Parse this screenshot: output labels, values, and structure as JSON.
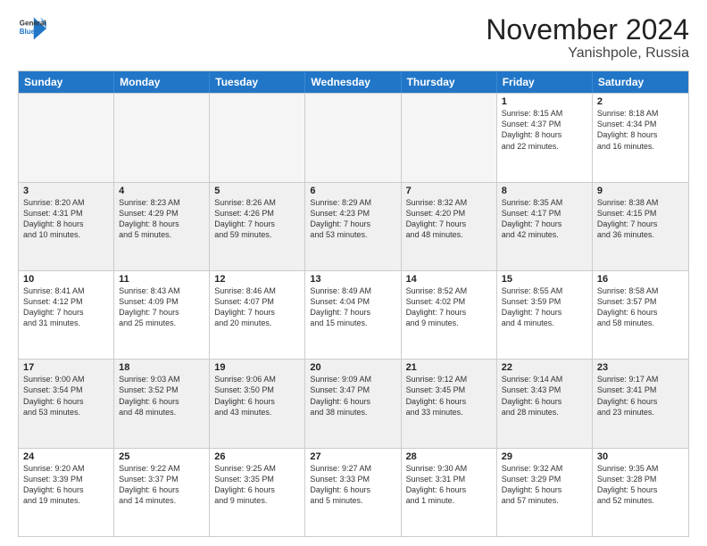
{
  "logo": {
    "general": "General",
    "blue": "Blue"
  },
  "title": "November 2024",
  "location": "Yanishpole, Russia",
  "days": [
    "Sunday",
    "Monday",
    "Tuesday",
    "Wednesday",
    "Thursday",
    "Friday",
    "Saturday"
  ],
  "weeks": [
    [
      {
        "day": "",
        "info": ""
      },
      {
        "day": "",
        "info": ""
      },
      {
        "day": "",
        "info": ""
      },
      {
        "day": "",
        "info": ""
      },
      {
        "day": "",
        "info": ""
      },
      {
        "day": "1",
        "info": "Sunrise: 8:15 AM\nSunset: 4:37 PM\nDaylight: 8 hours\nand 22 minutes."
      },
      {
        "day": "2",
        "info": "Sunrise: 8:18 AM\nSunset: 4:34 PM\nDaylight: 8 hours\nand 16 minutes."
      }
    ],
    [
      {
        "day": "3",
        "info": "Sunrise: 8:20 AM\nSunset: 4:31 PM\nDaylight: 8 hours\nand 10 minutes."
      },
      {
        "day": "4",
        "info": "Sunrise: 8:23 AM\nSunset: 4:29 PM\nDaylight: 8 hours\nand 5 minutes."
      },
      {
        "day": "5",
        "info": "Sunrise: 8:26 AM\nSunset: 4:26 PM\nDaylight: 7 hours\nand 59 minutes."
      },
      {
        "day": "6",
        "info": "Sunrise: 8:29 AM\nSunset: 4:23 PM\nDaylight: 7 hours\nand 53 minutes."
      },
      {
        "day": "7",
        "info": "Sunrise: 8:32 AM\nSunset: 4:20 PM\nDaylight: 7 hours\nand 48 minutes."
      },
      {
        "day": "8",
        "info": "Sunrise: 8:35 AM\nSunset: 4:17 PM\nDaylight: 7 hours\nand 42 minutes."
      },
      {
        "day": "9",
        "info": "Sunrise: 8:38 AM\nSunset: 4:15 PM\nDaylight: 7 hours\nand 36 minutes."
      }
    ],
    [
      {
        "day": "10",
        "info": "Sunrise: 8:41 AM\nSunset: 4:12 PM\nDaylight: 7 hours\nand 31 minutes."
      },
      {
        "day": "11",
        "info": "Sunrise: 8:43 AM\nSunset: 4:09 PM\nDaylight: 7 hours\nand 25 minutes."
      },
      {
        "day": "12",
        "info": "Sunrise: 8:46 AM\nSunset: 4:07 PM\nDaylight: 7 hours\nand 20 minutes."
      },
      {
        "day": "13",
        "info": "Sunrise: 8:49 AM\nSunset: 4:04 PM\nDaylight: 7 hours\nand 15 minutes."
      },
      {
        "day": "14",
        "info": "Sunrise: 8:52 AM\nSunset: 4:02 PM\nDaylight: 7 hours\nand 9 minutes."
      },
      {
        "day": "15",
        "info": "Sunrise: 8:55 AM\nSunset: 3:59 PM\nDaylight: 7 hours\nand 4 minutes."
      },
      {
        "day": "16",
        "info": "Sunrise: 8:58 AM\nSunset: 3:57 PM\nDaylight: 6 hours\nand 58 minutes."
      }
    ],
    [
      {
        "day": "17",
        "info": "Sunrise: 9:00 AM\nSunset: 3:54 PM\nDaylight: 6 hours\nand 53 minutes."
      },
      {
        "day": "18",
        "info": "Sunrise: 9:03 AM\nSunset: 3:52 PM\nDaylight: 6 hours\nand 48 minutes."
      },
      {
        "day": "19",
        "info": "Sunrise: 9:06 AM\nSunset: 3:50 PM\nDaylight: 6 hours\nand 43 minutes."
      },
      {
        "day": "20",
        "info": "Sunrise: 9:09 AM\nSunset: 3:47 PM\nDaylight: 6 hours\nand 38 minutes."
      },
      {
        "day": "21",
        "info": "Sunrise: 9:12 AM\nSunset: 3:45 PM\nDaylight: 6 hours\nand 33 minutes."
      },
      {
        "day": "22",
        "info": "Sunrise: 9:14 AM\nSunset: 3:43 PM\nDaylight: 6 hours\nand 28 minutes."
      },
      {
        "day": "23",
        "info": "Sunrise: 9:17 AM\nSunset: 3:41 PM\nDaylight: 6 hours\nand 23 minutes."
      }
    ],
    [
      {
        "day": "24",
        "info": "Sunrise: 9:20 AM\nSunset: 3:39 PM\nDaylight: 6 hours\nand 19 minutes."
      },
      {
        "day": "25",
        "info": "Sunrise: 9:22 AM\nSunset: 3:37 PM\nDaylight: 6 hours\nand 14 minutes."
      },
      {
        "day": "26",
        "info": "Sunrise: 9:25 AM\nSunset: 3:35 PM\nDaylight: 6 hours\nand 9 minutes."
      },
      {
        "day": "27",
        "info": "Sunrise: 9:27 AM\nSunset: 3:33 PM\nDaylight: 6 hours\nand 5 minutes."
      },
      {
        "day": "28",
        "info": "Sunrise: 9:30 AM\nSunset: 3:31 PM\nDaylight: 6 hours\nand 1 minute."
      },
      {
        "day": "29",
        "info": "Sunrise: 9:32 AM\nSunset: 3:29 PM\nDaylight: 5 hours\nand 57 minutes."
      },
      {
        "day": "30",
        "info": "Sunrise: 9:35 AM\nSunset: 3:28 PM\nDaylight: 5 hours\nand 52 minutes."
      }
    ]
  ]
}
